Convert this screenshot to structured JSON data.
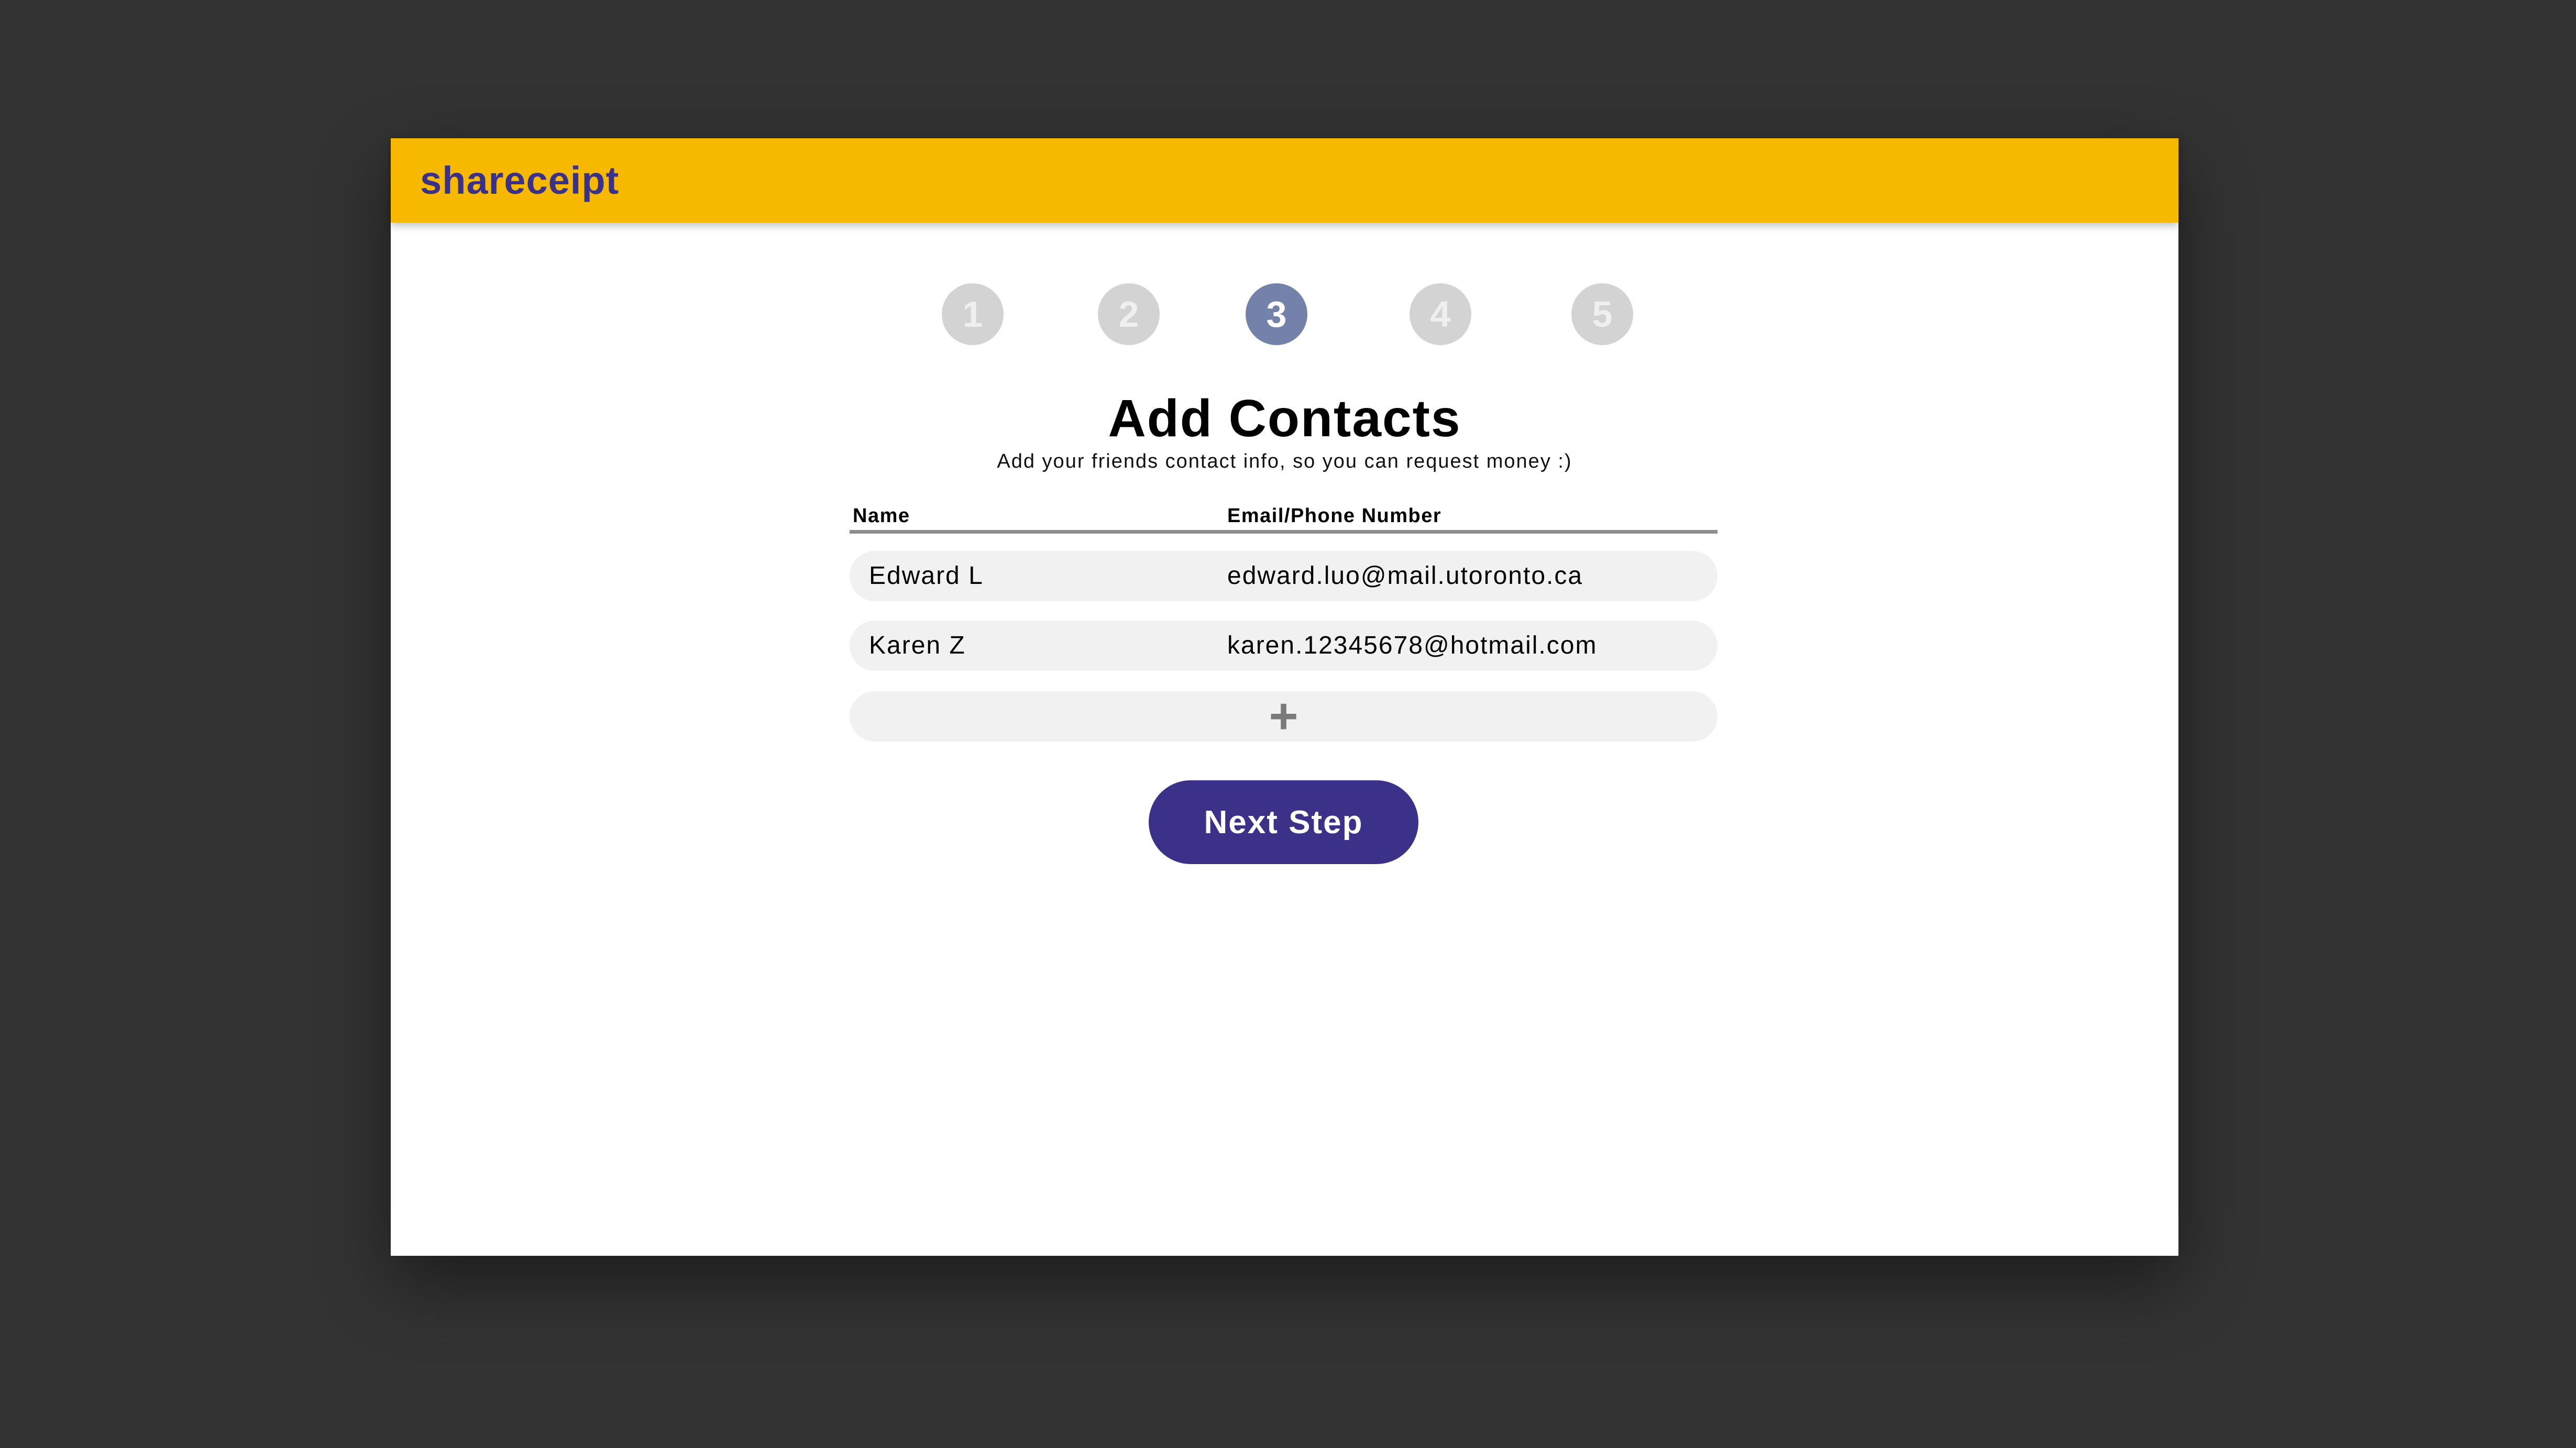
{
  "app": {
    "title": "shareceipt"
  },
  "stepper": {
    "steps": [
      "1",
      "2",
      "3",
      "4",
      "5"
    ],
    "active_step": "3"
  },
  "page": {
    "heading": "Add Contacts",
    "subheading": "Add your friends contact info, so you can request money :)"
  },
  "contacts_table": {
    "columns": [
      "Name",
      "Email/Phone Number"
    ],
    "rows": [
      {
        "name": "Edward L",
        "contact": "edward.luo@mail.utoronto.ca"
      },
      {
        "name": "Karen Z",
        "contact": "karen.12345678@hotmail.com"
      }
    ],
    "add_icon": "plus-icon"
  },
  "actions": {
    "next_label": "Next Step"
  },
  "colors": {
    "app_bar": "#f6b900",
    "brand": "#3c3189",
    "active_step": "#7481ab",
    "inactive_step": "#d3d3d3",
    "row_background": "#f1f1f1",
    "backdrop": "#333333"
  }
}
